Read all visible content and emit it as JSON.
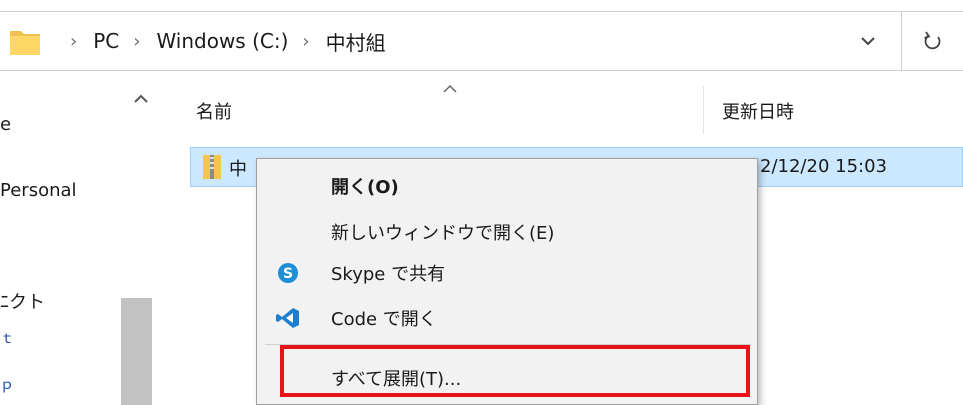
{
  "address_bar": {
    "crumbs": [
      "PC",
      "Windows (C:)",
      "中村組"
    ],
    "separator": "›"
  },
  "nav_pane": {
    "items": [
      "e",
      "Personal",
      "ﾆクト",
      "ｔ",
      "ｐ"
    ]
  },
  "columns": {
    "name_header": "名前",
    "date_header": "更新日時"
  },
  "file": {
    "name": "中",
    "modified": "2/12/20 15:03"
  },
  "context_menu": {
    "items": [
      {
        "label": "開く(O)",
        "icon": "none"
      },
      {
        "label": "新しいウィンドウで開く(E)",
        "icon": "none"
      },
      {
        "label": "Skype で共有",
        "icon": "skype-icon"
      },
      {
        "label": "Code で開く",
        "icon": "vscode-icon"
      },
      {
        "label": "すべて展開(T)...",
        "icon": "none"
      }
    ]
  },
  "colors": {
    "highlight": "#e6141a",
    "selection_bg": "#cce8ff",
    "menu_bg": "#f2f2f2",
    "skype": "#1e8fd6",
    "vscode": "#1f7fcf"
  }
}
